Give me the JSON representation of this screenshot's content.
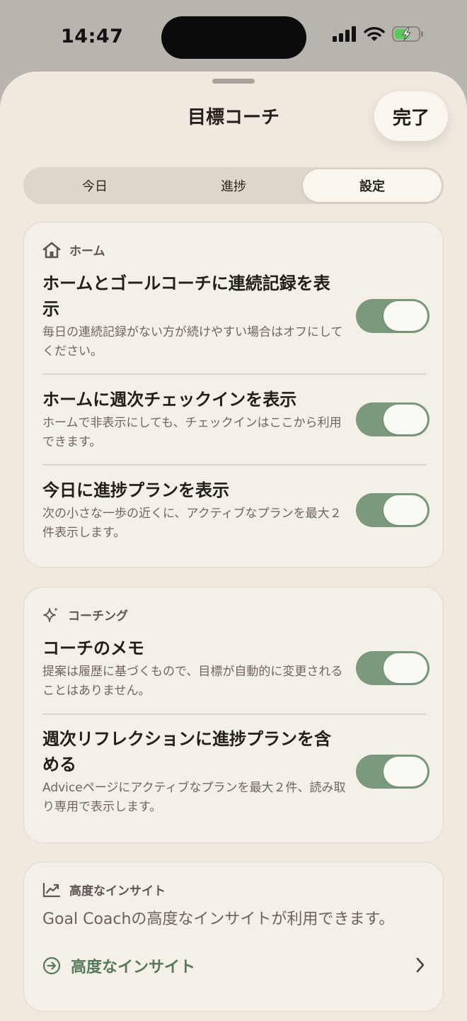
{
  "status_bar": {
    "time": "14:47"
  },
  "sheet": {
    "title": "目標コーチ",
    "done_label": "完了"
  },
  "tabs": [
    {
      "label": "今日",
      "active": false
    },
    {
      "label": "進捗",
      "active": false
    },
    {
      "label": "設定",
      "active": true
    }
  ],
  "sections": {
    "home": {
      "header": "ホーム",
      "icon": "house-icon",
      "rows": [
        {
          "title": "ホームとゴールコーチに連続記録を表示",
          "desc": "毎日の連続記録がない方が続けやすい場合はオフにしてください。",
          "on": true
        },
        {
          "title": "ホームに週次チェックインを表示",
          "desc": "ホームで非表示にしても、チェックインはここから利用できます。",
          "on": true
        },
        {
          "title": "今日に進捗プランを表示",
          "desc": "次の小さな一歩の近くに、アクティブなプランを最大２件表示します。",
          "on": true
        }
      ]
    },
    "coaching": {
      "header": "コーチング",
      "icon": "sparkles-icon",
      "rows": [
        {
          "title": "コーチのメモ",
          "desc": "提案は履歴に基づくもので、目標が自動的に変更されることはありません。",
          "on": true
        },
        {
          "title": "週次リフレクションに進捗プランを含める",
          "desc": "Adviceページにアクティブなプランを最大２件、読み取り専用で表示します。",
          "on": true
        }
      ]
    },
    "insights": {
      "header": "高度なインサイト",
      "icon": "chart-trend-icon",
      "text": "Goal Coachの高度なインサイトが利用できます。",
      "link_label": "高度なインサイト"
    }
  },
  "colors": {
    "accent_green": "#7b9a7d",
    "link_green": "#56795a",
    "sheet_bg": "#efe9df"
  }
}
